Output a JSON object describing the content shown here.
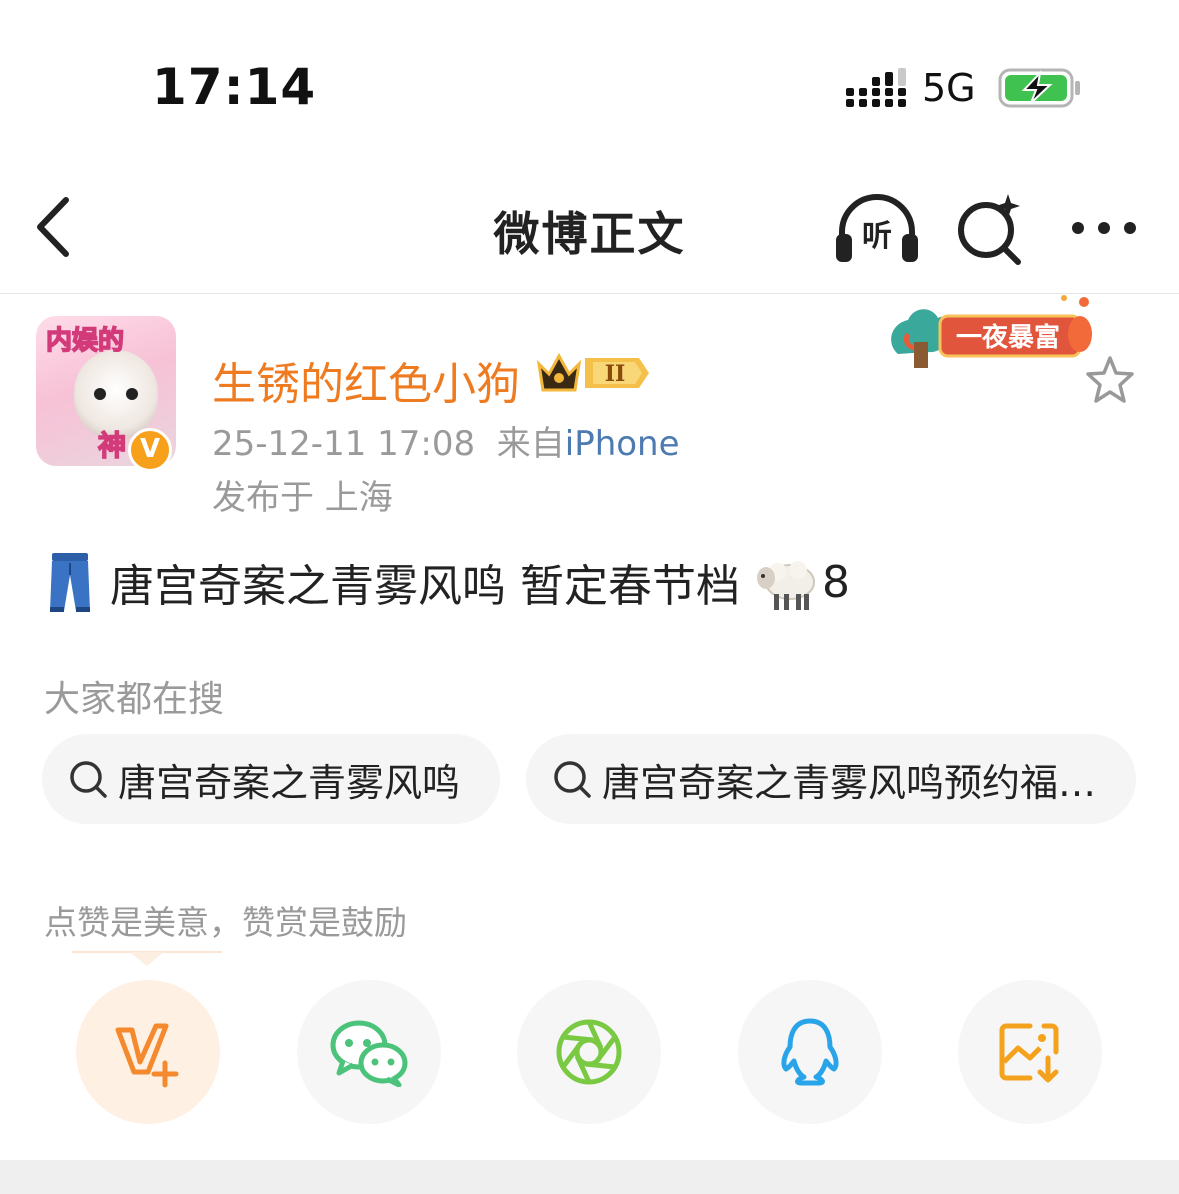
{
  "status_bar": {
    "time": "17:14",
    "network": "5G",
    "battery_state": "charging"
  },
  "nav": {
    "title": "微博正文",
    "listen_label": "听",
    "icons": [
      "back-icon",
      "listen-icon",
      "ai-search-icon",
      "more-icon"
    ]
  },
  "author": {
    "name": "生锈的红色小狗",
    "avatar_text_top": "内娱的",
    "avatar_text_bottom": "神",
    "verified_badge": "V",
    "vip_level": "II",
    "timestamp": "25-12-11 17:08",
    "source_prefix": "来自",
    "source": "iPhone",
    "location": "发布于 上海"
  },
  "promo_banner": {
    "text": "一夜暴富"
  },
  "post": {
    "text": "唐宫奇案之青雾风鸣 暂定春节档",
    "suffix": "8"
  },
  "search": {
    "heading": "大家都在搜",
    "items": [
      {
        "label": "唐宫奇案之青雾风鸣"
      },
      {
        "label": "唐宫奇案之青雾风鸣预约福…"
      }
    ]
  },
  "reward": {
    "tip": "点赞是美意，赞赏是鼓励"
  },
  "share": {
    "items": [
      {
        "icon": "reward-v-plus-icon",
        "color": "#f4892d"
      },
      {
        "icon": "wechat-icon",
        "color": "#4cc37b"
      },
      {
        "icon": "moments-icon",
        "color": "#7ac943"
      },
      {
        "icon": "qq-icon",
        "color": "#2aa4e8"
      },
      {
        "icon": "save-image-icon",
        "color": "#f4a21d"
      }
    ]
  },
  "colors": {
    "username": "#ef7b21",
    "source_link": "#4c7ab1",
    "secondary_text": "#9a9a9a",
    "chip_bg": "#f5f5f5"
  }
}
